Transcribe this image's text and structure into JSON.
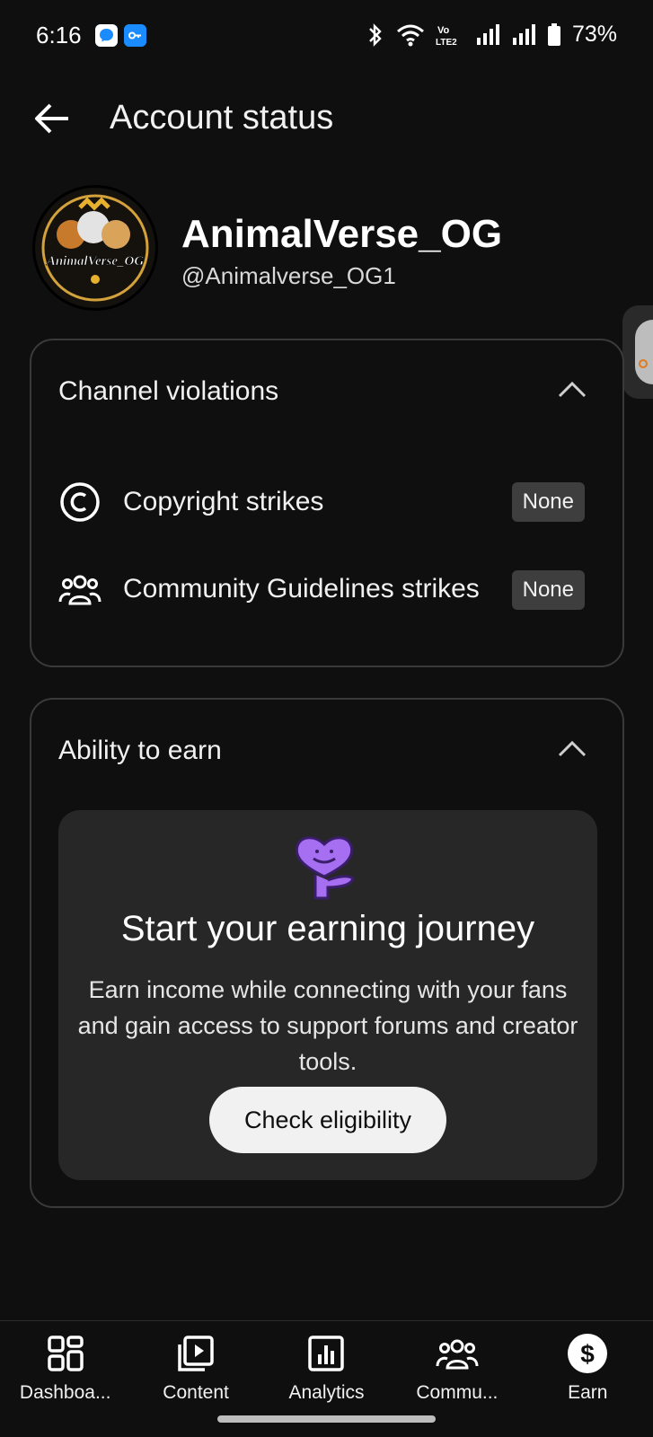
{
  "status_bar": {
    "time": "6:16",
    "battery": "73%",
    "icons": [
      "messenger-icon",
      "app-icon",
      "bluetooth-icon",
      "wifi-icon",
      "volte-icon",
      "signal-icon",
      "signal-icon",
      "battery-icon"
    ]
  },
  "header": {
    "title": "Account status",
    "back_icon": "arrow-left-icon"
  },
  "channel": {
    "name": "AnimalVerse_OG",
    "handle": "@Animalverse_OG1",
    "avatar_text": "AnimalVerse_OG"
  },
  "violations": {
    "title": "Channel violations",
    "rows": [
      {
        "label": "Copyright strikes",
        "status": "None",
        "icon": "copyright-icon"
      },
      {
        "label": "Community Guidelines strikes",
        "status": "None",
        "icon": "community-icon"
      }
    ]
  },
  "earn": {
    "title": "Ability to earn",
    "heading": "Start your earning journey",
    "description": "Earn income while connecting with your fans and gain access to support forums and creator tools.",
    "button_label": "Check eligibility"
  },
  "bottom_nav": {
    "items": [
      {
        "label": "Dashboa...",
        "icon": "dashboard-icon"
      },
      {
        "label": "Content",
        "icon": "content-icon"
      },
      {
        "label": "Analytics",
        "icon": "analytics-icon"
      },
      {
        "label": "Commu...",
        "icon": "community-icon"
      },
      {
        "label": "Earn",
        "icon": "dollar-icon"
      }
    ]
  },
  "colors": {
    "background": "#0f0f0f",
    "card_border": "#3a3a3a",
    "badge_bg": "#3e3e3e",
    "earn_box_bg": "#272727",
    "illustration": "#a66ef0"
  }
}
